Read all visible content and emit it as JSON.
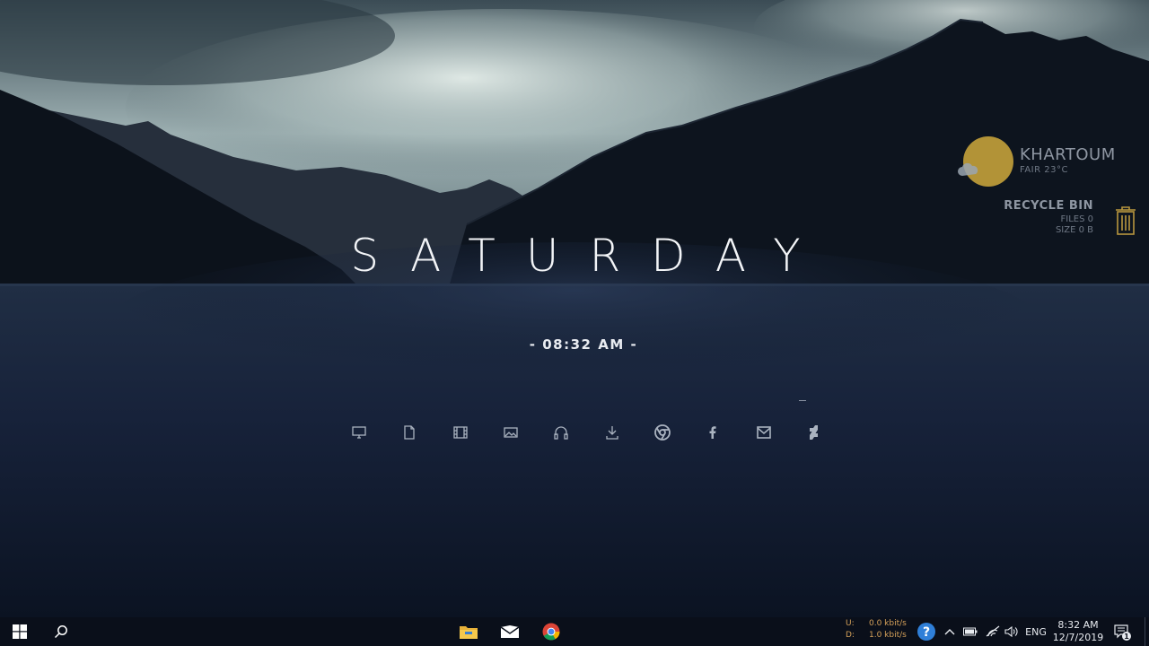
{
  "desktop": {
    "day": "SATURDAY",
    "time": "- 08:32 AM -",
    "dock": [
      {
        "name": "monitor-icon"
      },
      {
        "name": "document-icon"
      },
      {
        "name": "film-icon"
      },
      {
        "name": "image-icon"
      },
      {
        "name": "headphones-icon"
      },
      {
        "name": "download-icon"
      },
      {
        "name": "chrome-icon"
      },
      {
        "name": "facebook-icon"
      },
      {
        "name": "mail-icon"
      },
      {
        "name": "deviantart-icon"
      }
    ]
  },
  "weather": {
    "city": "KHARTOUM",
    "condition": "FAIR 23°C",
    "sun_color": "#c4a13a"
  },
  "recycle_bin": {
    "title": "RECYCLE BIN",
    "files": "FILES 0",
    "size": "SIZE 0 B"
  },
  "taskbar": {
    "pinned": [
      "folder-icon",
      "mail-icon",
      "chrome-icon"
    ],
    "net": {
      "upload_label": "U:",
      "upload_value": "0.0 kbit/s",
      "download_label": "D:",
      "download_value": "1.0 kbit/s"
    },
    "language": "ENG",
    "clock_time": "8:32 AM",
    "clock_date": "12/7/2019",
    "notification_count": "1"
  },
  "colors": {
    "accent_orange": "#d5a15a",
    "taskbar_bg": "#0a0f1a"
  }
}
